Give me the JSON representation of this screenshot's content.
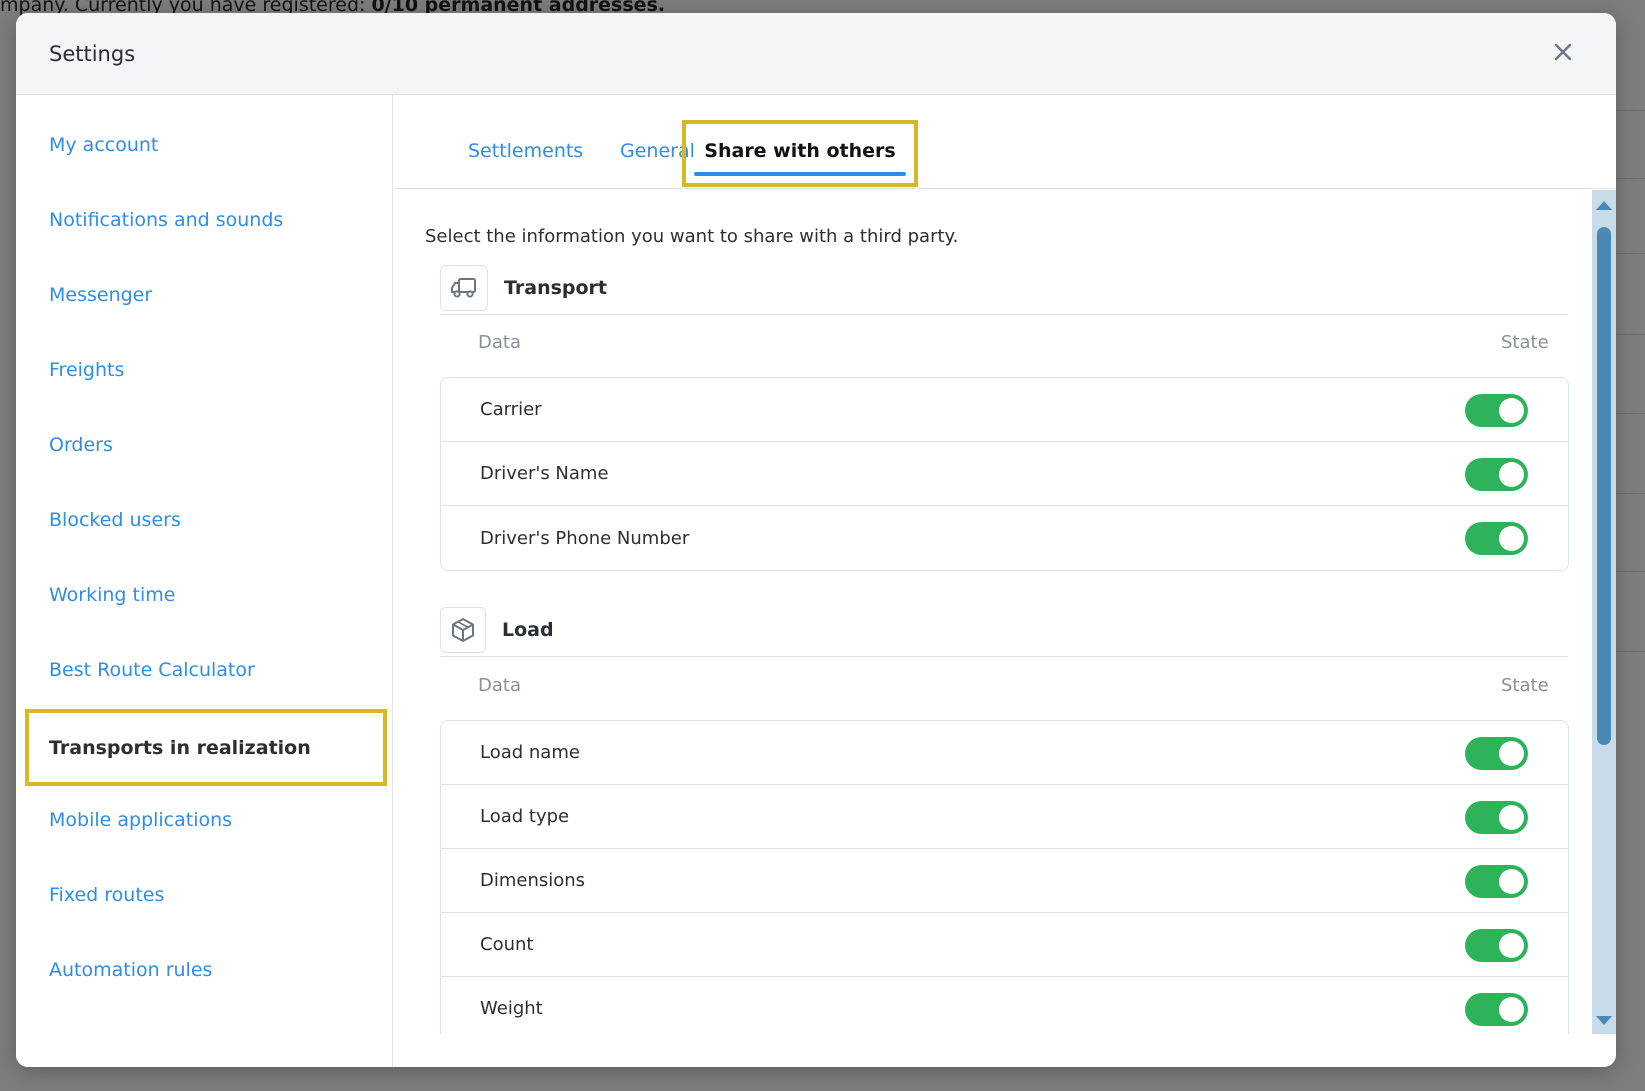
{
  "background": {
    "top_text_prefix": "mpany. Currently you have registered: ",
    "top_text_bold": "0/10 permanent addresses."
  },
  "modal": {
    "title": "Settings"
  },
  "sidebar": {
    "items": [
      {
        "label": "My account"
      },
      {
        "label": "Notifications and sounds"
      },
      {
        "label": "Messenger"
      },
      {
        "label": "Freights"
      },
      {
        "label": "Orders"
      },
      {
        "label": "Blocked users"
      },
      {
        "label": "Working time"
      },
      {
        "label": "Best Route Calculator"
      },
      {
        "label": "Transports in realization"
      },
      {
        "label": "Mobile applications"
      },
      {
        "label": "Fixed routes"
      },
      {
        "label": "Automation rules"
      }
    ],
    "active_index": 8
  },
  "tabs": [
    {
      "label": "Settlements"
    },
    {
      "label": "General"
    },
    {
      "label": "Share with others"
    }
  ],
  "content": {
    "intro": "Select the information you want to share with a third party.",
    "sections": [
      {
        "title": "Transport",
        "icon": "truck-icon",
        "col_data": "Data",
        "col_state": "State",
        "rows": [
          {
            "label": "Carrier",
            "enabled": true
          },
          {
            "label": "Driver's Name",
            "enabled": true
          },
          {
            "label": "Driver's Phone Number",
            "enabled": true
          }
        ]
      },
      {
        "title": "Load",
        "icon": "box-icon",
        "col_data": "Data",
        "col_state": "State",
        "rows": [
          {
            "label": "Load name",
            "enabled": true
          },
          {
            "label": "Load type",
            "enabled": true
          },
          {
            "label": "Dimensions",
            "enabled": true
          },
          {
            "label": "Count",
            "enabled": true
          },
          {
            "label": "Weight",
            "enabled": true
          }
        ]
      }
    ]
  },
  "colors": {
    "accent": "#2f8de8",
    "highlight": "#d9b825",
    "toggle_on": "#2fb35a",
    "scroll_thumb": "#4a89b5"
  }
}
